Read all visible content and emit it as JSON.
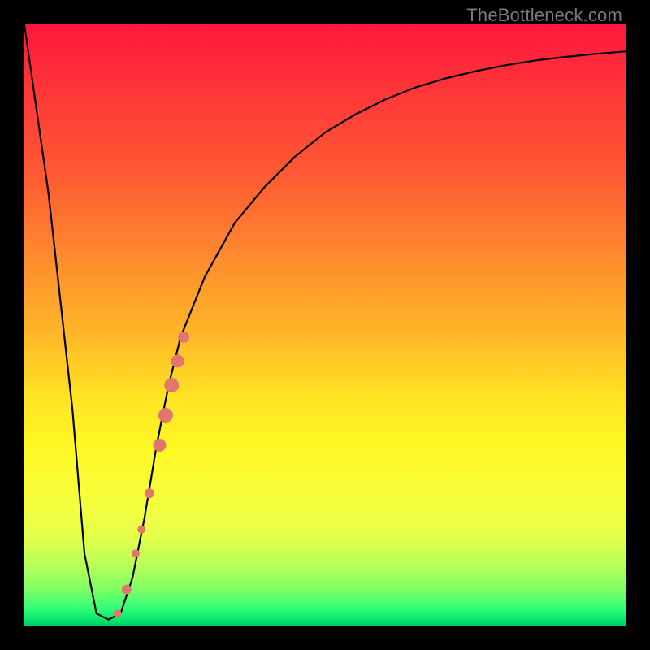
{
  "attribution": "TheBottleneck.com",
  "chart_data": {
    "type": "line",
    "title": "",
    "xlabel": "",
    "ylabel": "",
    "xlim": [
      0,
      100
    ],
    "ylim": [
      0,
      100
    ],
    "series": [
      {
        "name": "bottleneck-curve",
        "x": [
          0,
          4,
          8,
          10,
          12,
          14,
          16,
          18,
          20,
          22,
          24,
          26,
          30,
          35,
          40,
          45,
          50,
          55,
          60,
          65,
          70,
          75,
          80,
          85,
          90,
          95,
          100
        ],
        "y": [
          100,
          72,
          36,
          12,
          2,
          1,
          2,
          8,
          18,
          30,
          40,
          48,
          58,
          67,
          73,
          78,
          82,
          85,
          87.5,
          89.5,
          91,
          92.2,
          93.2,
          94,
          94.6,
          95.1,
          95.5
        ]
      }
    ],
    "markers": [
      {
        "name": "highlight-dot",
        "x": 15.5,
        "y": 2,
        "r": 5
      },
      {
        "name": "highlight-dot",
        "x": 17.0,
        "y": 6,
        "r": 6
      },
      {
        "name": "highlight-dot",
        "x": 18.5,
        "y": 12,
        "r": 5
      },
      {
        "name": "highlight-dot",
        "x": 19.5,
        "y": 16,
        "r": 5
      },
      {
        "name": "highlight-dot",
        "x": 20.8,
        "y": 22,
        "r": 6
      },
      {
        "name": "highlight-dot",
        "x": 22.5,
        "y": 30,
        "r": 8
      },
      {
        "name": "highlight-dot",
        "x": 23.5,
        "y": 35,
        "r": 9
      },
      {
        "name": "highlight-dot",
        "x": 24.5,
        "y": 40,
        "r": 9
      },
      {
        "name": "highlight-dot",
        "x": 25.5,
        "y": 44,
        "r": 8
      },
      {
        "name": "highlight-dot",
        "x": 26.5,
        "y": 48,
        "r": 7
      }
    ],
    "colors": {
      "curve": "#000000",
      "marker": "#e0766d",
      "gradient_top": "#ff173e",
      "gradient_mid": "#ffe324",
      "gradient_bottom": "#00c968",
      "frame": "#000000"
    }
  }
}
